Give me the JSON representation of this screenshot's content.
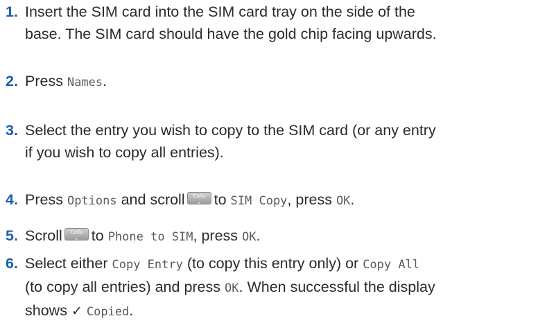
{
  "steps": [
    {
      "number": "1",
      "lines": [
        "Insert the SIM card into the SIM card tray on the side of the",
        "base. The SIM card should have the gold chip facing upwards."
      ]
    },
    {
      "number": "2",
      "press": "Press",
      "lcd": "Names",
      "end": "."
    },
    {
      "number": "3",
      "lines": [
        "Select the entry you wish to copy to the SIM card (or any entry",
        "if you wish to copy all entries)."
      ]
    },
    {
      "number": "4",
      "press": "Press",
      "lcd_options": "Options",
      "and_scroll": "and scroll",
      "to": "to",
      "lcd_simcopy": "SIM Copy",
      "press_ok": ", press",
      "lcd_ok": "OK",
      "end": "."
    },
    {
      "number": "5",
      "scroll": "Scroll",
      "to": "to",
      "lcd_phone": "Phone to SIM",
      "press_ok": ", press",
      "lcd_ok": "OK",
      "end": "."
    },
    {
      "number": "6",
      "select_either": "Select either",
      "lcd_copy_entry": "Copy Entry",
      "paren_1": "(to copy this entry only) or",
      "lcd_copy_all": "Copy All",
      "paren_2": "(to copy all entries) and press",
      "lcd_ok": "OK",
      "success": ". When successful the display",
      "shows": "shows",
      "tick": "✓",
      "lcd_copied": "Copied",
      "end": "."
    }
  ],
  "calls_key": {
    "label": "Calls",
    "icon": "chevron-down-icon"
  },
  "colors": {
    "step_number": "#1c5fa8",
    "body_text": "#2b2b2b",
    "lcd_text": "#5a5a5a"
  }
}
